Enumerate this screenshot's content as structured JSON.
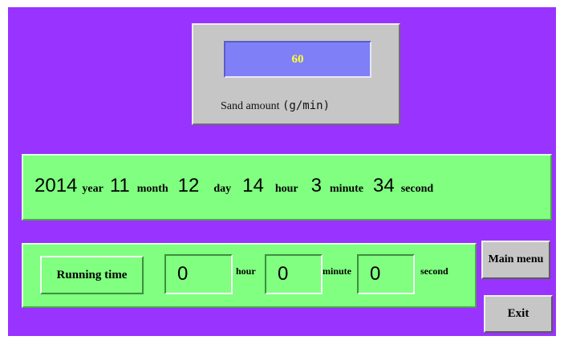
{
  "sand": {
    "value": "60",
    "label": "Sand amount",
    "unit": "(g/min)"
  },
  "datetime": {
    "year": "2014",
    "year_label": "year",
    "month": "11",
    "month_label": "month",
    "day": "12",
    "day_label": "day",
    "hour": "14",
    "hour_label": "hour",
    "minute": "3",
    "minute_label": "minute",
    "second": "34",
    "second_label": "second"
  },
  "running": {
    "button_label": "Running time",
    "hours": "0",
    "hour_label": "hour",
    "minutes": "0",
    "minute_label": "minute",
    "seconds": "0",
    "second_label": "second"
  },
  "buttons": {
    "main_menu": "Main menu",
    "exit": "Exit"
  },
  "colors": {
    "background": "#9933ff",
    "panel_green": "#80ff80",
    "panel_gray": "#c6c6c6",
    "display_blue": "#7f7ff7",
    "value_yellow": "#ffff33"
  }
}
